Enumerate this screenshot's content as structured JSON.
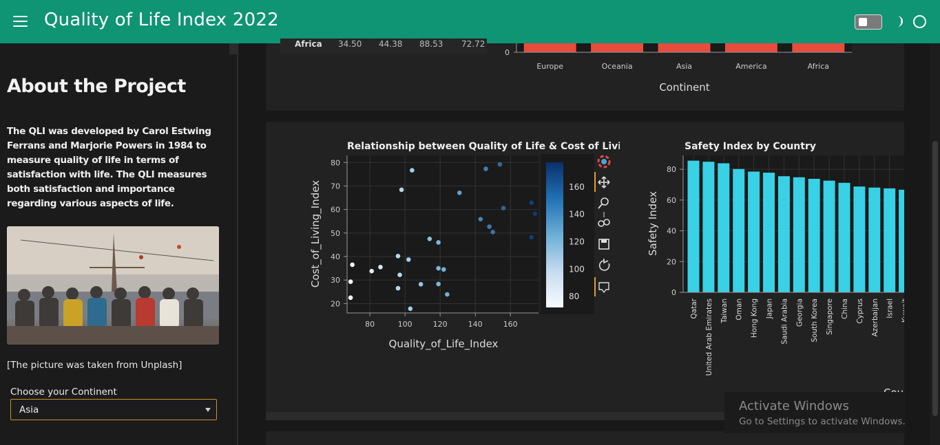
{
  "header": {
    "title": "Quality of Life Index 2022"
  },
  "sidebar": {
    "about_title": "About the Project",
    "about_text": "The QLI was developed by Carol Estwing Ferrans and Marjorie Powers in 1984 to measure quality of life in terms of satisfaction with life. The QLI measures both satisfaction and importance regarding various aspects of life.",
    "caption": "[The picture was taken from Unplash]",
    "select_label": "Choose your Continent",
    "select_value": "Asia"
  },
  "top_table_row": {
    "cells": [
      "Africa",
      "34.50",
      "44.38",
      "88.53",
      "72.72"
    ]
  },
  "windows_watermark": {
    "line1": "Activate Windows",
    "line2": "Go to Settings to activate Windows."
  },
  "colors": {
    "header": "#0f9474",
    "bar_top": "#e74c3c",
    "bar_safety": "#38d1e6",
    "select_border": "#c8942f"
  },
  "chart_data": [
    {
      "type": "bar",
      "title": "",
      "xlabel": "Continent",
      "categories": [
        "Europe",
        "Oceania",
        "Asia",
        "America",
        "Africa"
      ],
      "yticks": [
        0
      ],
      "note": "partially visible, scrolled"
    },
    {
      "type": "scatter",
      "title": "Relationship between Quality of Life & Cost of Living",
      "xlabel": "Quality_of_Life_Index",
      "ylabel": "Cost_of_Living_Index",
      "xlim": [
        67,
        176
      ],
      "ylim": [
        16,
        83
      ],
      "xticks": [
        80,
        100,
        120,
        140,
        160
      ],
      "yticks": [
        20,
        30,
        40,
        50,
        60,
        70,
        80
      ],
      "colorbar_ticks": [
        80,
        100,
        120,
        140,
        160
      ],
      "colorbar_range": [
        72,
        178
      ],
      "points": [
        {
          "x": 69,
          "y": 22.5
        },
        {
          "x": 69,
          "y": 29.3
        },
        {
          "x": 70,
          "y": 36.5
        },
        {
          "x": 81,
          "y": 33.8
        },
        {
          "x": 86,
          "y": 35.5
        },
        {
          "x": 96,
          "y": 40.2
        },
        {
          "x": 97,
          "y": 32.2
        },
        {
          "x": 96,
          "y": 26.5
        },
        {
          "x": 98,
          "y": 68.4
        },
        {
          "x": 102,
          "y": 38.7
        },
        {
          "x": 103,
          "y": 17.8
        },
        {
          "x": 104,
          "y": 76.7
        },
        {
          "x": 109,
          "y": 28.2
        },
        {
          "x": 114,
          "y": 47.5
        },
        {
          "x": 119,
          "y": 46.0
        },
        {
          "x": 119,
          "y": 35.0
        },
        {
          "x": 119,
          "y": 28.3
        },
        {
          "x": 122,
          "y": 34.5
        },
        {
          "x": 124,
          "y": 23.9
        },
        {
          "x": 131,
          "y": 67.1
        },
        {
          "x": 143,
          "y": 55.9
        },
        {
          "x": 146,
          "y": 77.3
        },
        {
          "x": 148,
          "y": 52.7
        },
        {
          "x": 150,
          "y": 50.4
        },
        {
          "x": 154,
          "y": 79.2
        },
        {
          "x": 156,
          "y": 60.6
        },
        {
          "x": 172,
          "y": 62.9
        },
        {
          "x": 174,
          "y": 58.2
        },
        {
          "x": 172,
          "y": 48.2
        }
      ]
    },
    {
      "type": "bar",
      "title": "Safety Index by Country",
      "ylabel": "Safety Index",
      "xlabel": "Cou",
      "ylim": [
        0,
        89
      ],
      "yticks": [
        0,
        20,
        40,
        60,
        80
      ],
      "categories": [
        "Qatar",
        "United Arab Emirates",
        "Taiwan",
        "Oman",
        "Hong Kong",
        "Japan",
        "Saudi Arabia",
        "Georgia",
        "South Korea",
        "Singapore",
        "China",
        "Cyprus",
        "Azerbaijan",
        "Israel",
        "Kuwait"
      ],
      "values": [
        85.6,
        84.9,
        83.9,
        80.2,
        78.5,
        77.8,
        75.5,
        74.8,
        73.8,
        72.6,
        71.2,
        68.8,
        68.1,
        67.6,
        66.7
      ]
    }
  ]
}
